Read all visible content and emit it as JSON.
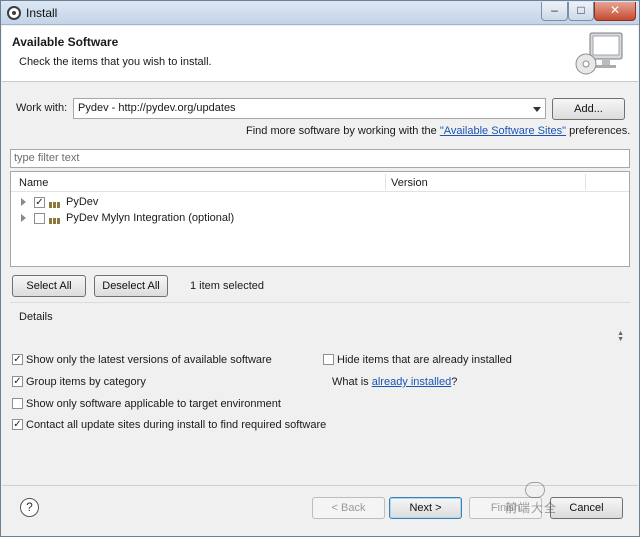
{
  "window": {
    "title": "Install"
  },
  "banner": {
    "title": "Available Software",
    "subtitle": "Check the items that you wish to install."
  },
  "work_with": {
    "label": "Work with:",
    "value": "Pydev - http://pydev.org/updates",
    "add_label": "Add...",
    "more_prefix": "Find more software by working with the ",
    "more_link": "\"Available Software Sites\"",
    "more_suffix": " preferences."
  },
  "filter": {
    "placeholder": "type filter text"
  },
  "tree": {
    "columns": [
      "Name",
      "Version"
    ],
    "rows": [
      {
        "label": "PyDev",
        "checked": true
      },
      {
        "label": "PyDev Mylyn Integration (optional)",
        "checked": false
      }
    ]
  },
  "selection": {
    "select_all": "Select All",
    "deselect_all": "Deselect All",
    "status": "1 item selected"
  },
  "details": {
    "label": "Details"
  },
  "options": {
    "latest_versions": {
      "label": "Show only the latest versions of available software",
      "checked": true
    },
    "hide_installed": {
      "label": "Hide items that are already installed",
      "checked": false
    },
    "group_by_category": {
      "label": "Group items by category",
      "checked": true
    },
    "what_is_prefix": "What is ",
    "what_is_link": "already installed",
    "what_is_suffix": "?",
    "target_env": {
      "label": "Show only software applicable to target environment",
      "checked": false
    },
    "contact_sites": {
      "label": "Contact all update sites during install to find required software",
      "checked": true
    }
  },
  "footer": {
    "help": "?",
    "back": "< Back",
    "next": "Next >",
    "finish": "Finish",
    "cancel": "Cancel",
    "watermark": "前端大全"
  },
  "icons": {
    "app": "eclipse-icon",
    "banner": "install-monitor-icon",
    "package": "feature-package-icon",
    "help": "help-icon"
  }
}
